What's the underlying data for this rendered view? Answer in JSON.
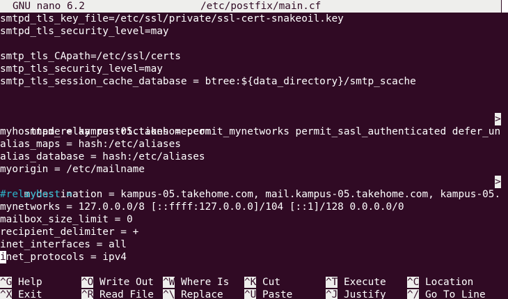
{
  "title_bar": {
    "app": "GNU nano 6.2",
    "file": "/etc/postfix/main.cf"
  },
  "lines": [
    "smtpd_tls_key_file=/etc/ssl/private/ssl-cert-snakeoil.key",
    "smtpd_tls_security_level=may",
    "",
    "",
    "smtp_tls_CApath=/etc/ssl/certs",
    "smtp_tls_security_level=may",
    "smtp_tls_session_cache_database = btree:${data_directory}/smtp_scache",
    "",
    "",
    "smtpd_relay_restrictions = permit_mynetworks permit_sasl_authenticated defer_un",
    "myhostname = kampus-05.takehome.com",
    "alias_maps = hash:/etc/aliases",
    "alias_database = hash:/etc/aliases",
    "myorigin = /etc/mailname",
    "mydestination = kampus-05.takehome.com, mail.kampus-05.takehome.com, kampus-05.",
    "#relayhost =",
    "mynetworks = 127.0.0.0/8 [::ffff:127.0.0.0]/104 [::1]/128 0.0.0.0/0",
    "mailbox_size_limit = 0",
    "recipient_delimiter = +",
    "inet_interfaces = all"
  ],
  "cursor_line": {
    "cursor_char": "i",
    "rest": "net_protocols = ipv4"
  },
  "overflow_marker": ">",
  "shortcuts_row1": [
    {
      "key": "^G",
      "label": "Help"
    },
    {
      "key": "^O",
      "label": "Write Out"
    },
    {
      "key": "^W",
      "label": "Where Is"
    },
    {
      "key": "^K",
      "label": "Cut"
    },
    {
      "key": "^T",
      "label": "Execute"
    },
    {
      "key": "^C",
      "label": "Location"
    }
  ],
  "shortcuts_row2": [
    {
      "key": "^X",
      "label": "Exit"
    },
    {
      "key": "^R",
      "label": "Read File"
    },
    {
      "key": "^\\",
      "label": "Replace"
    },
    {
      "key": "^U",
      "label": "Paste"
    },
    {
      "key": "^J",
      "label": "Justify"
    },
    {
      "key": "^/",
      "label": "Go To Line"
    }
  ],
  "colors": {
    "background": "#300a24",
    "foreground": "#ffffff",
    "comment": "#2bb3c9",
    "inverse_background": "#eeeeec"
  }
}
